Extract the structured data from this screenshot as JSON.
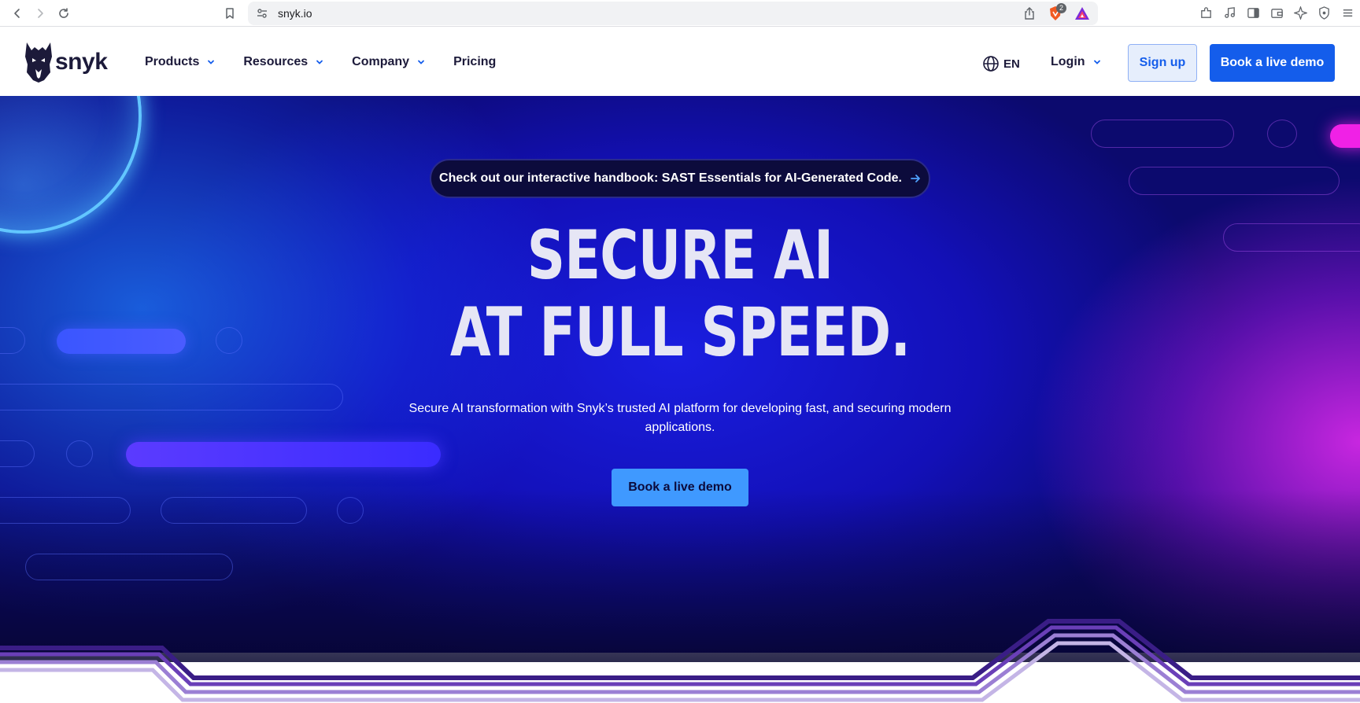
{
  "browser": {
    "url": "snyk.io",
    "brave_badge_count": "2",
    "icons": [
      "back-icon",
      "forward-icon",
      "reload-icon",
      "bookmark-icon",
      "site-settings-icon",
      "share-icon",
      "brave-shield-icon",
      "brave-rewards-icon",
      "extensions-icon",
      "media-icon",
      "sidebar-icon",
      "wallet-icon",
      "leo-ai-icon",
      "vpn-icon",
      "menu-icon"
    ]
  },
  "header": {
    "logo_text": "snyk",
    "nav": [
      {
        "label": "Products",
        "has_dropdown": true
      },
      {
        "label": "Resources",
        "has_dropdown": true
      },
      {
        "label": "Company",
        "has_dropdown": true
      },
      {
        "label": "Pricing",
        "has_dropdown": false
      }
    ],
    "language": "EN",
    "login_label": "Login",
    "signup_label": "Sign up",
    "demo_label": "Book a live demo"
  },
  "hero": {
    "announcement": "Check out our interactive handbook: SAST Essentials for AI-Generated Code.",
    "headline_line1": "SECURE AI",
    "headline_line2": "AT FULL SPEED.",
    "subtitle": "Secure AI transformation with Snyk’s trusted AI platform for developing fast, and securing modern applications.",
    "cta_label": "Book a live demo"
  },
  "colors": {
    "brand_blue": "#145deb",
    "navy_text": "#1c1a3a",
    "hero_cta": "#3f99ff",
    "accent_pink": "#f021e6",
    "stripe_purple": "#5b2ea6",
    "stripe_lavender": "#b8a6dc"
  }
}
